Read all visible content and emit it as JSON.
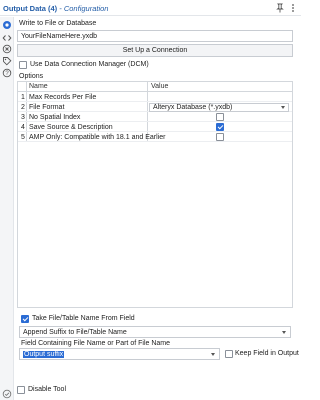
{
  "titlebar": {
    "title": "Output Data (4)",
    "subtitle": "- Configuration",
    "pin_icon": "pin-icon",
    "menu_icon": "more-vertical-icon"
  },
  "rail": {
    "icons": [
      "gear-icon",
      "code-icon",
      "circle-x-icon",
      "tag-icon",
      "help-icon"
    ],
    "bottom_icon": "check-circle-icon"
  },
  "write_section": {
    "label": "Write to File or Database",
    "file_value": "YourFileNameHere.yxdb",
    "connection_button": "Set Up a Connection",
    "dcm_checkbox_label": "Use Data Connection Manager (DCM)",
    "dcm_checked": false
  },
  "options": {
    "label": "Options",
    "columns": [
      "Name",
      "Value"
    ],
    "rows": [
      {
        "num": "1",
        "name": "Max Records Per File",
        "type": "text",
        "value": ""
      },
      {
        "num": "2",
        "name": "File Format",
        "type": "select",
        "value": "Alteryx Database (*.yxdb)"
      },
      {
        "num": "3",
        "name": "No Spatial Index",
        "type": "checkbox",
        "checked": false
      },
      {
        "num": "4",
        "name": "Save Source & Description",
        "type": "checkbox",
        "checked": true
      },
      {
        "num": "5",
        "name": "AMP Only: Compatible with 18.1 and Earlier",
        "type": "checkbox",
        "checked": false
      }
    ]
  },
  "take_name": {
    "checkbox_label": "Take File/Table Name From Field",
    "checked": true,
    "mode_value": "Append Suffix to File/Table Name",
    "field_label": "Field Containing File Name or Part of File Name",
    "field_value": "Output suffix",
    "keep_field_label": "Keep Field in Output",
    "keep_field_checked": false
  },
  "disable_tool": {
    "label": "Disable Tool",
    "checked": false
  },
  "colors": {
    "accent": "#2b6cd4",
    "title": "#245ea8"
  }
}
